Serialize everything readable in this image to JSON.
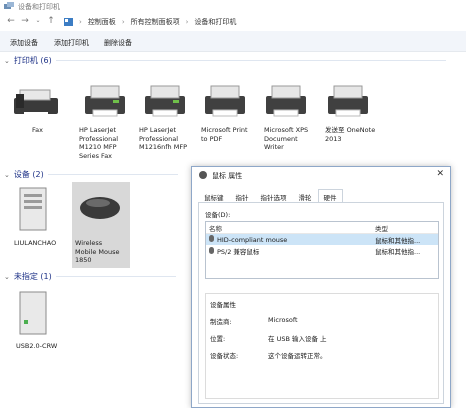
{
  "window": {
    "title": "设备和打印机"
  },
  "breadcrumb": [
    "控制面板",
    "所有控制面板项",
    "设备和打印机"
  ],
  "toolbar": {
    "add_device": "添加设备",
    "add_printer": "添加打印机",
    "remove_device": "删除设备"
  },
  "sections": {
    "printers": {
      "label": "打印机 (6)"
    },
    "devices": {
      "label": "设备 (2)"
    },
    "unspecified": {
      "label": "未指定 (1)"
    }
  },
  "printers": [
    {
      "lines": [
        "Fax"
      ]
    },
    {
      "lines": [
        "HP LaserJet",
        "Professional",
        "M1210 MFP",
        "Series Fax"
      ]
    },
    {
      "lines": [
        "HP LaserJet",
        "Professional",
        "M1216nfh MFP"
      ]
    },
    {
      "lines": [
        "Microsoft Print",
        "to PDF"
      ]
    },
    {
      "lines": [
        "Microsoft XPS",
        "Document",
        "Writer"
      ]
    },
    {
      "lines": [
        "发送至 OneNote",
        "2013"
      ]
    }
  ],
  "devices": [
    {
      "lines": [
        "LIULANCHAO"
      ]
    },
    {
      "lines": [
        "Wireless",
        "Mobile Mouse",
        "1850"
      ]
    }
  ],
  "unspecified": [
    {
      "lines": [
        "USB2.0-CRW"
      ]
    }
  ],
  "dialog": {
    "title": "鼠标 属性",
    "tabs": [
      "鼠标键",
      "指针",
      "指针选项",
      "滑轮",
      "硬件"
    ],
    "devices_label": "设备(D):",
    "columns": {
      "name": "名称",
      "type": "类型"
    },
    "rows": [
      {
        "name": "HID-compliant mouse",
        "type": "鼠标和其他指..."
      },
      {
        "name": "PS/2 兼容鼠标",
        "type": "鼠标和其他指..."
      }
    ],
    "properties": {
      "title": "设备属性",
      "manufacturer_label": "制造商:",
      "manufacturer": "Microsoft",
      "location_label": "位置:",
      "location": "在 USB 输入设备 上",
      "status_label": "设备状态:",
      "status": "这个设备运转正常。"
    }
  },
  "colors": {
    "section": "#1e3287",
    "selection": "#cce4f7",
    "tile_selected": "#d8d8d8"
  }
}
